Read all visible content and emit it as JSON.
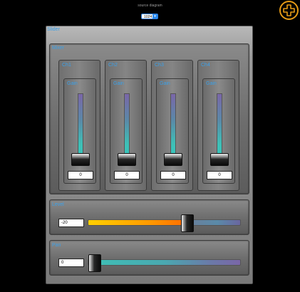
{
  "header": {
    "title": "source diagram",
    "size_select": {
      "value": "1024"
    }
  },
  "main_panel": {
    "label": "Slider"
  },
  "mixer_panel": {
    "label": "Mixer"
  },
  "channels": [
    {
      "label": "Ch1",
      "inner_label": "Gain",
      "value": "0"
    },
    {
      "label": "Ch2",
      "inner_label": "Gain",
      "value": "0"
    },
    {
      "label": "Ch3",
      "inner_label": "Gain",
      "value": "0"
    },
    {
      "label": "Ch4",
      "inner_label": "Gain",
      "value": "0"
    }
  ],
  "horizontal_sliders": [
    {
      "label": "Level",
      "value": "-20"
    },
    {
      "label": "Pan",
      "value": "0"
    }
  ],
  "colors": {
    "accent_label": "#3aa0e8",
    "plus_button": "#e59a16",
    "fill_start": "#ffd000",
    "fill_end": "#ff6a00"
  },
  "icons": {
    "add_button": "plus-circle-icon",
    "dropdown": "chevron-down-icon"
  }
}
